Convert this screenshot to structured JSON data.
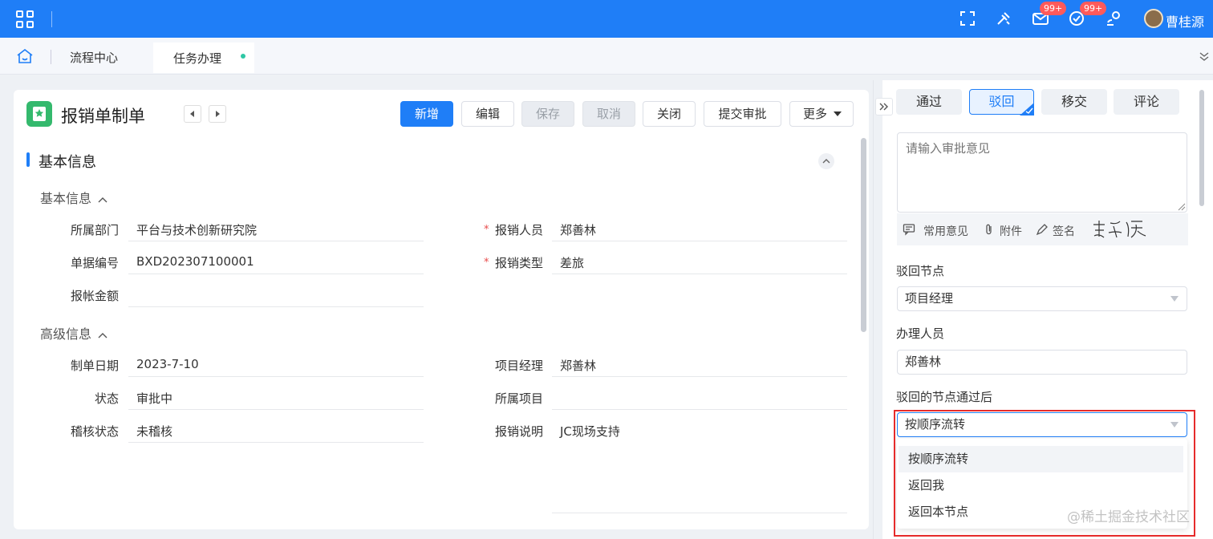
{
  "topbar": {
    "badge_mail": "99+",
    "badge_task": "99+",
    "user_name": "曹桂源"
  },
  "tabs": {
    "items": [
      {
        "label": "流程中心"
      },
      {
        "label": "任务办理"
      }
    ]
  },
  "document": {
    "title": "报销单制单",
    "buttons": {
      "add": "新增",
      "edit": "编辑",
      "save": "保存",
      "cancel": "取消",
      "close": "关闭",
      "submit": "提交审批",
      "more": "更多"
    },
    "section_title": "基本信息",
    "groups": {
      "basic": "基本信息",
      "advanced": "高级信息"
    },
    "fields": {
      "dept": {
        "label": "所属部门",
        "value": "平台与技术创新研究院"
      },
      "applicant": {
        "label": "报销人员",
        "value": "郑善林"
      },
      "doc_no": {
        "label": "单据编号",
        "value": "BXD202307100001"
      },
      "type": {
        "label": "报销类型",
        "value": "差旅"
      },
      "amount": {
        "label": "报帐金额",
        "value": ""
      },
      "date": {
        "label": "制单日期",
        "value": "2023-7-10"
      },
      "pm": {
        "label": "项目经理",
        "value": "郑善林"
      },
      "status": {
        "label": "状态",
        "value": "审批中"
      },
      "project": {
        "label": "所属项目",
        "value": ""
      },
      "audit_status": {
        "label": "稽核状态",
        "value": "未稽核"
      },
      "desc": {
        "label": "报销说明",
        "value": "JC现场支持"
      }
    }
  },
  "sidepanel": {
    "actions": {
      "pass": "通过",
      "reject": "驳回",
      "transfer": "移交",
      "comment": "评论"
    },
    "opinion_placeholder": "请输入审批意见",
    "tools": {
      "common": "常用意见",
      "attach": "附件",
      "sign": "签名"
    },
    "reject_node_label": "驳回节点",
    "reject_node_value": "项目经理",
    "handler_label": "办理人员",
    "handler_value": "郑善林",
    "after_pass_label": "驳回的节点通过后",
    "after_pass_value": "按顺序流转",
    "options": [
      "按顺序流转",
      "返回我",
      "返回本节点"
    ]
  },
  "watermark": "@稀土掘金技术社区",
  "colors": {
    "brand": "#1f7ef7",
    "highlight_box": "#e62b2b",
    "logo": "#34b96d"
  }
}
